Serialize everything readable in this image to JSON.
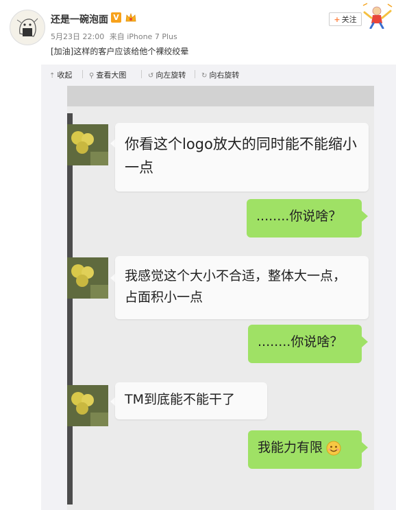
{
  "post": {
    "username": "还是一碗泡面",
    "verified_badge": "V",
    "date": "5月23日 22:00",
    "source": "来自 iPhone 7 Plus",
    "text": "[加油]这样的客户应该给他个裸绞绞晕",
    "follow_label": "关注"
  },
  "toolbar": {
    "collapse_label": "收起",
    "view_large_label": "查看大图",
    "rotate_left_label": "向左旋转",
    "rotate_right_label": "向右旋转"
  },
  "chat": {
    "msg1": "你看这个logo放大的同时能不能缩小一点",
    "reply1": "........你说啥？",
    "msg2": "我感觉这个大小不合适，整体大一点，占面积小一点",
    "reply2": "........你说啥？",
    "msg3": "TM到底能不能干了",
    "reply3": "我能力有限"
  },
  "icons": {
    "verified": "verified-badge-icon",
    "member": "member-crown-icon",
    "collapse": "collapse-arrow-icon",
    "view_large": "magnifier-icon",
    "rotate_left": "rotate-left-icon",
    "rotate_right": "rotate-right-icon",
    "emoji": "smile-emoji-icon"
  },
  "colors": {
    "accent": "#ff8140",
    "verified": "#f7a21c",
    "bubble_out": "#9fe165",
    "toolbar_bg": "#f2f2f5"
  }
}
